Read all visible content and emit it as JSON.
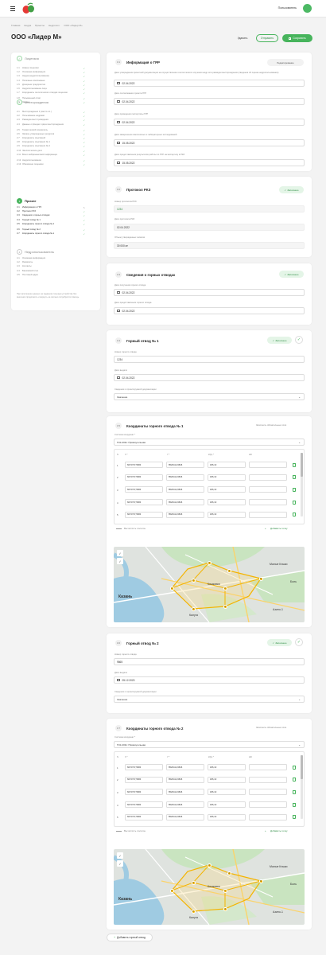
{
  "header": {
    "user": "Пользователь"
  },
  "breadcrumbs": [
    "Главная",
    "Недра",
    "Проекты",
    "Недропол.",
    "ООО «Лидер М»"
  ],
  "page": {
    "title": "ООО «Лидер М»",
    "delete": "Удалить",
    "send": "Отправить",
    "save": "Сохранить"
  },
  "sidebar": {
    "sections": [
      {
        "num": "✓",
        "title": "Лицензия",
        "items": [
          {
            "n": "1.1",
            "label": "Номер лицензии"
          },
          {
            "n": "1.2",
            "label": "Основная информация"
          },
          {
            "n": "1.3",
            "label": "Недра (недропользование)"
          },
          {
            "n": "1.4",
            "label": "Полезные ископаемые"
          },
          {
            "n": "1.5",
            "label": "Дочерние предприятия"
          },
          {
            "n": "1.6",
            "label": "Недропользование лица"
          },
          {
            "n": "1.7",
            "label": "Координаты геологических отводов лицензии"
          },
          {
            "n": "1.8",
            "label": "Письменный ответ"
          },
          {
            "n": "1.9",
            "label": "Заключ."
          }
        ]
      },
      {
        "num": "✓",
        "title": "Месторождения",
        "items": [
          {
            "n": "2.1",
            "label": "Месторождение 1 (место.пл.)"
          },
          {
            "n": "2.2",
            "label": "Пользование недрами"
          },
          {
            "n": "2.3",
            "label": "Разведка мест.проведения"
          },
          {
            "n": "2.4",
            "label": "Данные о фондах отдачи месторождения"
          },
          {
            "n": "2.5",
            "label": "Тематический показатель"
          },
          {
            "n": "2.6",
            "label": "Запасы утвержденных ресурсов"
          },
          {
            "n": "2.7",
            "label": "Координаты изысканий"
          },
          {
            "n": "2.8",
            "label": "Координаты изыскания № 1"
          },
          {
            "n": "2.9",
            "label": "Координаты изыскания № 2"
          },
          {
            "n": "2.10",
            "label": "Экологическое дело"
          },
          {
            "n": "2.11",
            "label": "Всего вебфинансовой информации"
          },
          {
            "n": "2.12",
            "label": "Недропользование"
          },
          {
            "n": "2.13",
            "label": "Обновлено лицензии"
          }
        ]
      },
      {
        "num": "3",
        "title": "Прочее",
        "items": [
          {
            "n": "3.1",
            "label": "Информация о ГРР"
          },
          {
            "n": "3.2",
            "label": "Протокол РКЗ"
          },
          {
            "n": "3.3",
            "label": "Сведения о горных отводах"
          },
          {
            "n": "3.4",
            "label": "Горный отвод № 1"
          },
          {
            "n": "3.5",
            "label": "Координаты горного отвода № 1"
          },
          {
            "n": "3.6",
            "label": "Горный отвод № 2"
          },
          {
            "n": "3.7",
            "label": "Координаты горного отвода № 2"
          }
        ]
      },
      {
        "num": "4",
        "title": "Недропользователь",
        "items": [
          {
            "n": "4.1",
            "label": "Основная информация"
          },
          {
            "n": "4.2",
            "label": "Реквизиты"
          },
          {
            "n": "4.3",
            "label": "Контакты"
          },
          {
            "n": "4.4",
            "label": "Банковский счет"
          },
          {
            "n": "4.5",
            "label": "Почтовый адрес"
          }
        ]
      }
    ],
    "note": "При заполнении данных на заданном текущем устройстве без внесения продолжить и вернуть на сколько потребуется помощь."
  },
  "grr": {
    "step": "3.1",
    "title": "Информация о ГРР",
    "badge": "Редактирование",
    "f1_label": "Дата утверждения проектной документации на осуществление геологического изучения недр или разведки месторождения (сведения об оценке недропользования)",
    "f1": "02.04.2022",
    "f2_label": "Дата согласования проекта ГРР",
    "f2": "02.04.2022",
    "f3_label": "Дата проведения экспертизы ГРР",
    "f3": "02.04.2022",
    "f4_label": "Дата завершения комплексных и лабораторных исследований",
    "f4": "15.05.2022",
    "f5_label": "Дата предоставления результатов работы по ГРР на экспертизу в РКЗ",
    "f5": "15.05.2022"
  },
  "rkz": {
    "step": "3.2",
    "title": "Протокол РКЗ",
    "badge": "Заполнено",
    "l1": "Номер протокола РКЗ",
    "v1": "1234",
    "l2": "Дата протокола РКЗ",
    "v2": "02.04.2022",
    "l3": "Объем утвержденных запасов",
    "v3": "30 000 м³"
  },
  "otv": {
    "step": "3.3",
    "title": "Сведения о горных отводах",
    "badge": "Заполнено",
    "l1": "Дата получения горного отвода",
    "v1": "02.04.2022",
    "l2": "Дата предоставления горного отвода",
    "v2": "02.04.2022"
  },
  "g1": {
    "step": "3.4",
    "title": "Горный отвод № 1",
    "badge": "Заполнено",
    "l1": "Номер горного отвода",
    "v1": "1234",
    "l2": "Дата выдачи",
    "v2": "02.04.2022",
    "l3": "Сведения о проектируемой документации",
    "v3": "Значение"
  },
  "c1": {
    "step": "3.5",
    "title": "Координаты горного отвода № 1",
    "badge": "Заполнить обязательные поля",
    "sys_label": "Система координат *",
    "sys": "ГСК-2011: Прямоугольная",
    "cols": [
      "N",
      "X *",
      "Y *",
      "Z(H) *",
      "H/h"
    ],
    "rows": [
      {
        "n": "1",
        "x": "6072737,5684",
        "y": "8526414,9526",
        "z": "186,10"
      },
      {
        "n": "2",
        "x": "6072737,5684",
        "y": "8526414,9526",
        "z": "186,10"
      },
      {
        "n": "3",
        "x": "6072737,5684",
        "y": "8526414,9526",
        "z": "186,10"
      },
      {
        "n": "4",
        "x": "6072737,5684",
        "y": "8526414,9526",
        "z": "186,10"
      },
      {
        "n": "5",
        "x": "6072737,5684",
        "y": "8526414,9526",
        "z": "186,10"
      }
    ],
    "import": "Вычислить полигон",
    "add": "Добавить точку"
  },
  "g2": {
    "step": "3.6",
    "title": "Горный отвод № 2",
    "badge": "Заполнено",
    "l1": "Номер горного отвода",
    "v1": "9865",
    "l2": "Дата выдачи",
    "v2": "05.12.2023",
    "l3": "Сведения о проектируемой документации",
    "v3": "Значение"
  },
  "c2": {
    "step": "3.7",
    "title": "Координаты горного отвода № 2",
    "badge": "Заполнить обязательные поля",
    "sys_label": "Система координат *",
    "sys": "ГСК-2011: Прямоугольная",
    "cols": [
      "N",
      "X *",
      "Y *",
      "Z(H) *",
      "H/h"
    ],
    "rows": [
      {
        "n": "1",
        "x": "6072737,5684",
        "y": "8526414,9526",
        "z": "186,10"
      },
      {
        "n": "2",
        "x": "6072737,5684",
        "y": "8526414,9526",
        "z": "186,10"
      },
      {
        "n": "3",
        "x": "6072737,5684",
        "y": "8526414,9526",
        "z": "186,10"
      },
      {
        "n": "4",
        "x": "6072737,5684",
        "y": "8526414,9526",
        "z": "186,10"
      },
      {
        "n": "5",
        "x": "6072737,5684",
        "y": "8526414,9526",
        "z": "186,10"
      }
    ],
    "import": "Вычислить полигон",
    "add": "Добавить точку"
  },
  "map": {
    "city": "Казань",
    "kaluga": "Калуга",
    "klykovka": "Клыковка",
    "m_kliki": "Малые Клыки",
    "azino": "Азино-1",
    "bolsh": "Боль"
  },
  "add_otvod": "Добавить горный отвод",
  "colors": {
    "accent": "#47b45c",
    "accent_dark": "#2e8c44"
  }
}
